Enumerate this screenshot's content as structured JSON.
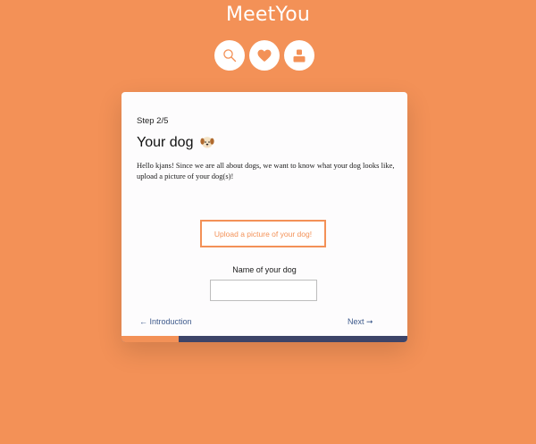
{
  "app": {
    "logo_text": "MeetYou"
  },
  "nav": {
    "items": [
      {
        "icon": "search-icon"
      },
      {
        "icon": "heart-icon"
      },
      {
        "icon": "profile-icon"
      }
    ]
  },
  "step": {
    "label": "Step 2/5",
    "progress": 0.2
  },
  "form": {
    "title": "Your dog",
    "title_icon": "dog-face-icon",
    "description": "Hello kjans! Since we are all about dogs, we want to know what your dog looks like, upload a picture of your dog(s)!",
    "upload_label": "Upload a picture of your dog!",
    "name_label": "Name of your dog",
    "name_value": "",
    "name_placeholder": ""
  },
  "navigation": {
    "prev_label": "← Introduction",
    "next_label": "Next ➞"
  },
  "colors": {
    "background": "#F39157",
    "accent": "#F39157",
    "link": "#3E5A8C",
    "progress_track": "#3D4468"
  }
}
